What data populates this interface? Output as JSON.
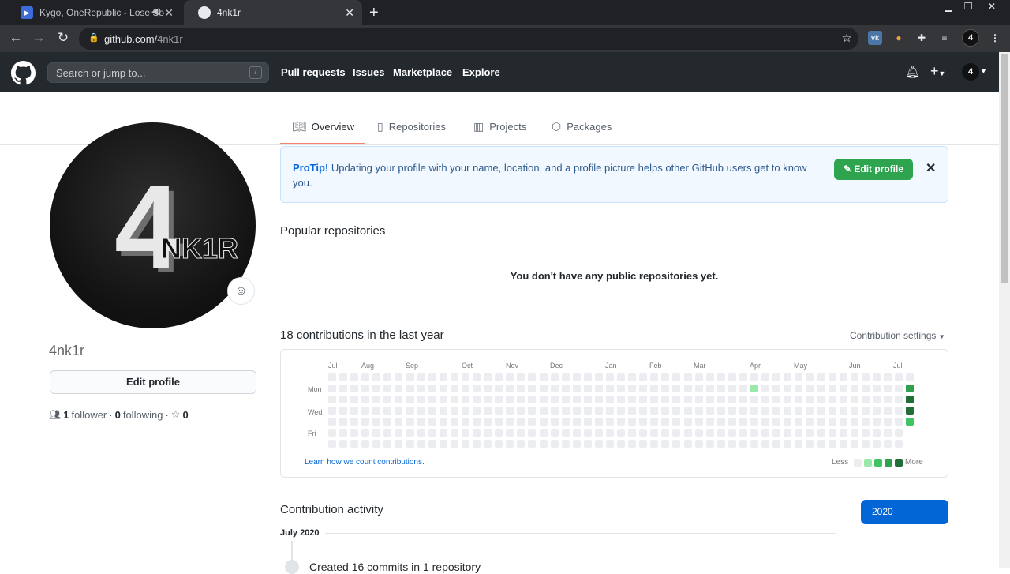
{
  "browser": {
    "tab1_title": "Kygo, OneRepublic - Lose So",
    "tab2_title": "4nk1r",
    "url_host": "github.com/",
    "url_path": "4nk1r"
  },
  "header": {
    "search_placeholder": "Search or jump to...",
    "search_shortcut": "/",
    "nav": [
      "Pull requests",
      "Issues",
      "Marketplace",
      "Explore"
    ]
  },
  "tabs": [
    "Overview",
    "Repositories",
    "Projects",
    "Packages"
  ],
  "profile": {
    "username": "4nk1r",
    "avatar_text_big": "4",
    "avatar_text": "NK1R",
    "edit_profile": "Edit profile",
    "followers": "1",
    "followers_label": "follower",
    "following": "0",
    "following_label": "following",
    "stars": "0"
  },
  "protip": {
    "label": "ProTip!",
    "text": " Updating your profile with your name, location, and a profile picture helps other GitHub users get to know you.",
    "button": "Edit profile"
  },
  "popular": {
    "title": "Popular repositories",
    "empty": "You don't have any public repositories yet."
  },
  "contributions": {
    "title": "18 contributions in the last year",
    "settings": "Contribution settings",
    "months": [
      "Jul",
      "Aug",
      "Sep",
      "Oct",
      "Nov",
      "Dec",
      "Jan",
      "Feb",
      "Mar",
      "Apr",
      "May",
      "Jun",
      "Jul"
    ],
    "days": [
      "Mon",
      "Wed",
      "Fri"
    ],
    "learn": "Learn how we count contributions.",
    "less": "Less",
    "more": "More",
    "colors": [
      "#ebedf0",
      "#9be9a8",
      "#40c463",
      "#30a14e",
      "#216e39"
    ]
  },
  "activity": {
    "title": "Contribution activity",
    "year": "2020",
    "month": "July 2020",
    "item": "Created 16 commits in 1 repository"
  }
}
